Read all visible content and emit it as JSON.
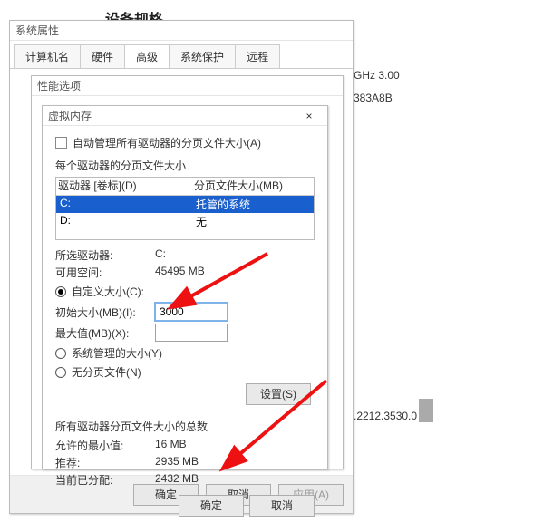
{
  "background": {
    "heading": "设备规格",
    "ghz_line": "GHz  3.00",
    "code_line": "383A8B",
    "ver_line": ".2212.3530.0"
  },
  "sys": {
    "title": "系统属性",
    "tabs": {
      "computer_name": "计算机名",
      "hardware": "硬件",
      "advanced": "高级",
      "protect": "系统保护",
      "remote": "远程"
    },
    "ok": "确定",
    "cancel": "取消",
    "apply": "应用(A)"
  },
  "perf": {
    "title": "性能选项"
  },
  "vm": {
    "title": "虚拟内存",
    "auto_label": "自动管理所有驱动器的分页文件大小(A)",
    "each_label": "每个驱动器的分页文件大小",
    "col_drive": "驱动器 [卷标](D)",
    "col_size": "分页文件大小(MB)",
    "drives": [
      {
        "letter": "C:",
        "size": "托管的系统",
        "selected": true
      },
      {
        "letter": "D:",
        "size": "无",
        "selected": false
      }
    ],
    "selected_drive_label": "所选驱动器:",
    "selected_drive_value": "C:",
    "free_label": "可用空间:",
    "free_value": "45495 MB",
    "radio_custom": "自定义大小(C):",
    "initial_label": "初始大小(MB)(I):",
    "initial_value": "3000",
    "max_label": "最大值(MB)(X):",
    "max_value": "",
    "radio_sys": "系统管理的大小(Y)",
    "radio_none": "无分页文件(N)",
    "set_btn": "设置(S)",
    "totals_heading": "所有驱动器分页文件大小的总数",
    "min_label": "允许的最小值:",
    "min_value": "16 MB",
    "rec_label": "推荐:",
    "rec_value": "2935 MB",
    "cur_label": "当前已分配:",
    "cur_value": "2432 MB",
    "ok": "确定",
    "cancel": "取消"
  }
}
